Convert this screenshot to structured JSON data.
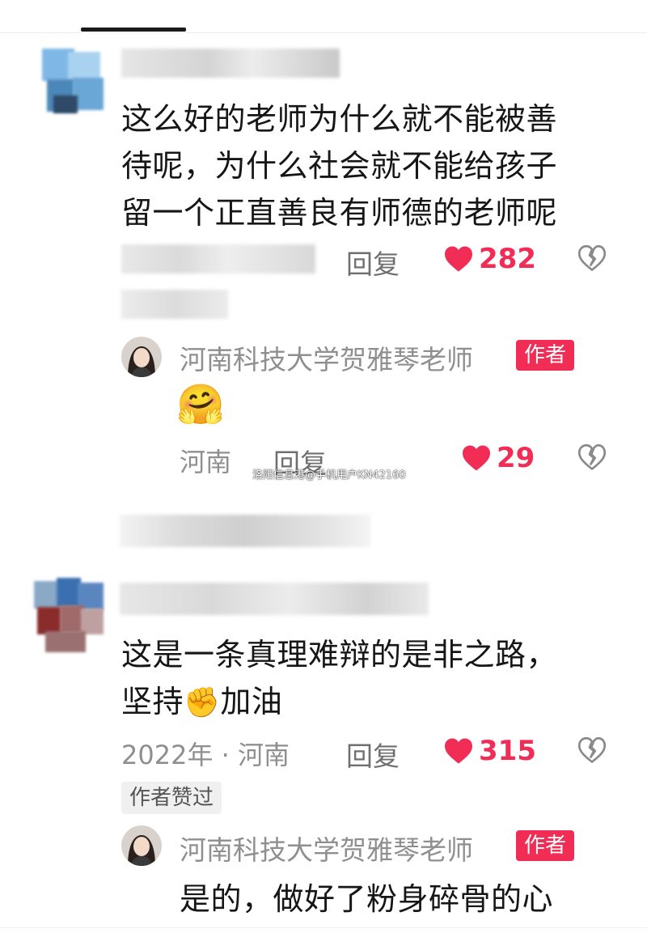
{
  "comment1": {
    "text": "这么好的老师为什么就不能被善待呢，为什么社会就不能给孩子留一个正直善良有师德的老师呢",
    "line1": "这么好的老师为什么就不能被善",
    "line2": "待呢，为什么社会就不能给孩子",
    "line3": "留一个正直善良有师德的老师呢",
    "reply_label": "回复",
    "likes": "282"
  },
  "reply1": {
    "author": "河南科技大学贺雅琴老师",
    "badge": "作者",
    "emoji": "🤗",
    "location": "河南",
    "reply_label": "回复",
    "likes": "29"
  },
  "watermark": "洛阳信息港@手机用户KN42160",
  "comment2": {
    "line1": "这是一条真理难辩的是非之路，",
    "line2_a": "坚持",
    "line2_emoji": "✊",
    "line2_b": "加油",
    "meta": "2022年 · 河南",
    "reply_label": "回复",
    "likes": "315",
    "liked_badge": "作者赞过"
  },
  "reply2": {
    "author": "河南科技大学贺雅琴老师",
    "badge": "作者",
    "text": "是的，做好了粉身碎骨的心"
  },
  "colors": {
    "accent": "#f12c55",
    "meta_text": "#8f8f8f",
    "body_text": "#161616"
  }
}
